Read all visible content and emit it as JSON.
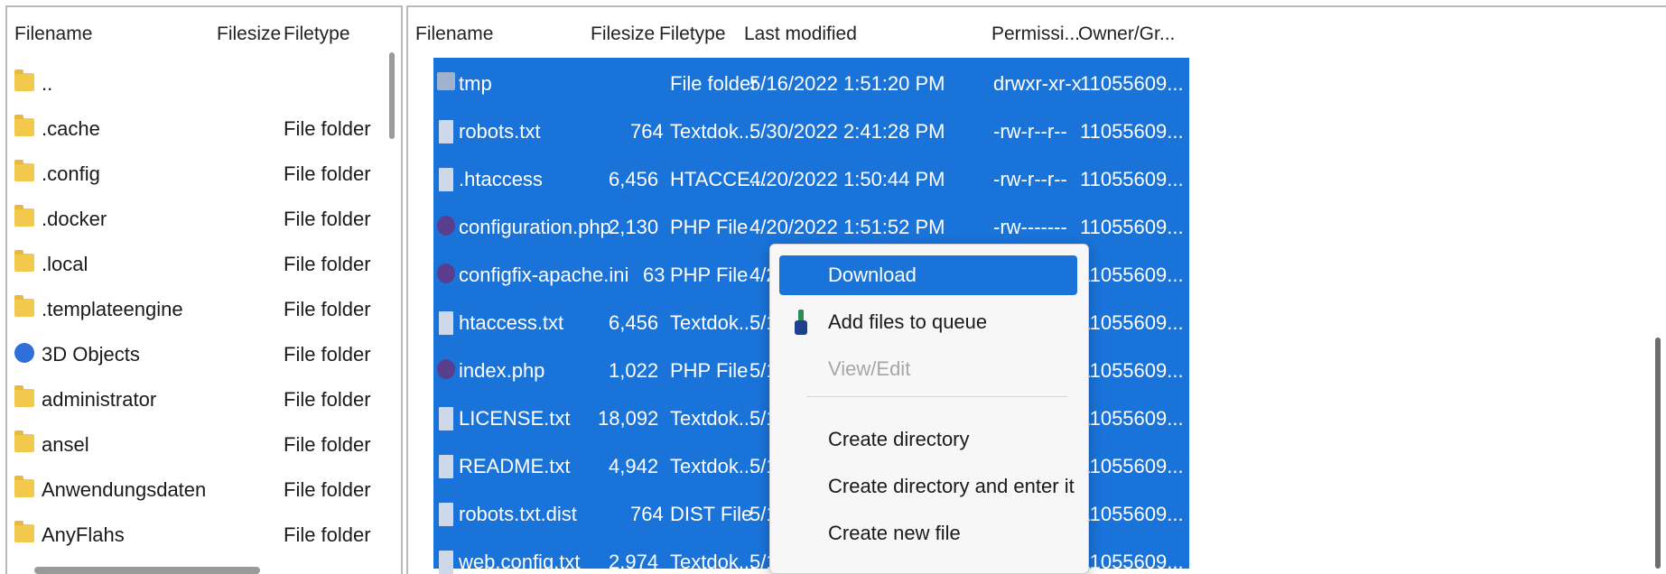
{
  "left_pane": {
    "columns": {
      "filename": "Filename",
      "filesize": "Filesize",
      "filetype": "Filetype"
    },
    "rows": [
      {
        "name": "..",
        "type": "",
        "icon": "folder-icon"
      },
      {
        "name": ".cache",
        "type": "File folder",
        "icon": "folder-icon"
      },
      {
        "name": ".config",
        "type": "File folder",
        "icon": "folder-icon"
      },
      {
        "name": ".docker",
        "type": "File folder",
        "icon": "folder-icon"
      },
      {
        "name": ".local",
        "type": "File folder",
        "icon": "folder-icon"
      },
      {
        "name": ".templateengine",
        "type": "File folder",
        "icon": "folder-icon"
      },
      {
        "name": "3D Objects",
        "type": "File folder",
        "icon": "3d-objects-icon"
      },
      {
        "name": "administrator",
        "type": "File folder",
        "icon": "folder-icon"
      },
      {
        "name": "ansel",
        "type": "File folder",
        "icon": "folder-icon"
      },
      {
        "name": "Anwendungsdaten",
        "type": "File folder",
        "icon": "folder-icon"
      },
      {
        "name": "AnyFlahs",
        "type": "File folder",
        "icon": "folder-icon"
      }
    ]
  },
  "right_pane": {
    "columns": {
      "filename": "Filename",
      "filesize": "Filesize",
      "filetype": "Filetype",
      "last_modified": "Last modified",
      "permissions": "Permissi...",
      "owner": "Owner/Gr..."
    },
    "rows": [
      {
        "name": "tmp",
        "size": "",
        "type": "File folder",
        "modified": "5/16/2022 1:51:20 PM",
        "perm": "drwxr-xr-x",
        "owner": "11055609...",
        "icon": "folder-icon"
      },
      {
        "name": "robots.txt",
        "size": "764",
        "type": "Textdok...",
        "modified": "5/30/2022 2:41:28 PM",
        "perm": "-rw-r--r--",
        "owner": "11055609...",
        "icon": "text-file-icon"
      },
      {
        "name": ".htaccess",
        "size": "6,456",
        "type": "HTACCE...",
        "modified": "4/20/2022 1:50:44 PM",
        "perm": "-rw-r--r--",
        "owner": "11055609...",
        "icon": "text-file-icon"
      },
      {
        "name": "configuration.php",
        "size": "2,130",
        "type": "PHP File",
        "modified": "4/20/2022 1:51:52 PM",
        "perm": "-rw-------",
        "owner": "11055609...",
        "icon": "php-file-icon"
      },
      {
        "name": "configfix-apache.ini",
        "size": "63",
        "type": "PHP File",
        "modified": "4/2",
        "perm": "",
        "owner": "11055609...",
        "icon": "php-file-icon"
      },
      {
        "name": "htaccess.txt",
        "size": "6,456",
        "type": "Textdok...",
        "modified": "5/1",
        "perm": "",
        "owner": "11055609...",
        "icon": "text-file-icon"
      },
      {
        "name": "index.php",
        "size": "1,022",
        "type": "PHP File",
        "modified": "5/1",
        "perm": "",
        "owner": "11055609...",
        "icon": "php-file-icon"
      },
      {
        "name": "LICENSE.txt",
        "size": "18,092",
        "type": "Textdok...",
        "modified": "5/1",
        "perm": "",
        "owner": "11055609...",
        "icon": "text-file-icon"
      },
      {
        "name": "README.txt",
        "size": "4,942",
        "type": "Textdok...",
        "modified": "5/1",
        "perm": "",
        "owner": "11055609...",
        "icon": "text-file-icon"
      },
      {
        "name": "robots.txt.dist",
        "size": "764",
        "type": "DIST File",
        "modified": "5/1",
        "perm": "",
        "owner": "11055609...",
        "icon": "text-file-icon"
      },
      {
        "name": "web.config.txt",
        "size": "2,974",
        "type": "Textdok...",
        "modified": "5/1",
        "perm": "",
        "owner": "11055609...",
        "icon": "text-file-icon"
      }
    ]
  },
  "context_menu": {
    "items": [
      {
        "label": "Download",
        "state": "highlighted"
      },
      {
        "label": "Add files to queue",
        "state": "normal",
        "icon": "add-to-queue-icon"
      },
      {
        "label": "View/Edit",
        "state": "disabled"
      },
      {
        "label": "Create directory",
        "state": "normal"
      },
      {
        "label": "Create directory and enter it",
        "state": "normal"
      },
      {
        "label": "Create new file",
        "state": "normal"
      }
    ]
  },
  "colors": {
    "selection": "#1a73d9",
    "folder": "#f2c94c",
    "menu_background": "#f7f7f7"
  }
}
